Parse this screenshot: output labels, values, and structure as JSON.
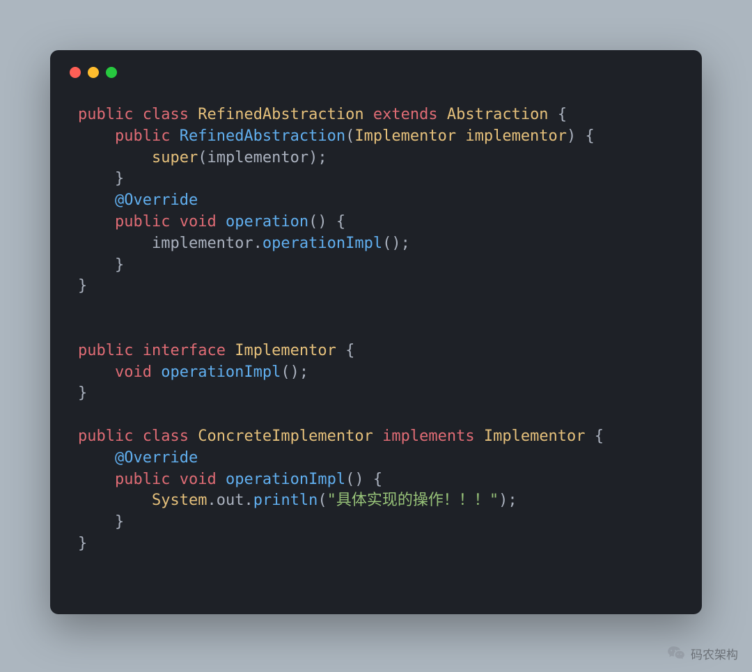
{
  "footer": {
    "brand": "码农架构"
  },
  "code": {
    "l1": {
      "public": "public",
      "class": "class",
      "name": "RefinedAbstraction",
      "extends": "extends",
      "super": "Abstraction",
      "brace": "{"
    },
    "l2": {
      "public": "public",
      "ctor": "RefinedAbstraction",
      "lp": "(",
      "ptype": "Implementor",
      "pname": "implementor",
      "rp": ")",
      "brace": "{"
    },
    "l3": {
      "super": "super",
      "lp": "(",
      "arg": "implementor",
      "rp": ");"
    },
    "l4": {
      "brace": "}"
    },
    "l5": {
      "ann": "@Override"
    },
    "l6": {
      "public": "public",
      "void": "void",
      "fn": "operation",
      "lp": "()",
      "brace": "{"
    },
    "l7": {
      "obj": "implementor",
      "dot": ".",
      "fn": "operationImpl",
      "call": "();"
    },
    "l8": {
      "brace": "}"
    },
    "l9": {
      "brace": "}"
    },
    "l10": {
      "public": "public",
      "interface": "interface",
      "name": "Implementor",
      "brace": "{"
    },
    "l11": {
      "void": "void",
      "fn": "operationImpl",
      "call": "();"
    },
    "l12": {
      "brace": "}"
    },
    "l13": {
      "public": "public",
      "class": "class",
      "name": "ConcreteImplementor",
      "implements": "implements",
      "iface": "Implementor",
      "brace": "{"
    },
    "l14": {
      "ann": "@Override"
    },
    "l15": {
      "public": "public",
      "void": "void",
      "fn": "operationImpl",
      "lp": "()",
      "brace": "{"
    },
    "l16": {
      "sys": "System",
      "d1": ".",
      "out": "out",
      "d2": ".",
      "println": "println",
      "lp": "(",
      "str": "\"具体实现的操作！！！\"",
      "rp": ");"
    },
    "l17": {
      "brace": "}"
    },
    "l18": {
      "brace": "}"
    }
  }
}
